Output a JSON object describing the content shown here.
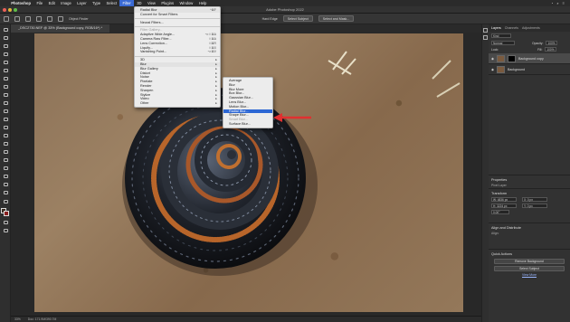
{
  "menubar": {
    "app": "Photoshop",
    "items": [
      "File",
      "Edit",
      "Image",
      "Layer",
      "Type",
      "Select",
      "Filter",
      "3D",
      "View",
      "Plugins",
      "Window",
      "Help"
    ],
    "active": "Filter"
  },
  "window": {
    "title": "Adobe Photoshop 2022",
    "tab": "_DSC2730.NEF @ 33% (Background copy, RGB/16*) *"
  },
  "options": {
    "object_finder": "Object Finder",
    "hard_edge": "Hard Edge",
    "select_subject": "Select Subject",
    "select_mask": "Select and Mask..."
  },
  "filter_menu": {
    "items": [
      {
        "label": "Radial Blur",
        "shortcut": "^⌘F",
        "state": "highlight"
      },
      {
        "label": "Convert for Smart Filters"
      },
      {
        "sep": true
      },
      {
        "label": "Neural Filters..."
      },
      {
        "sep": true
      },
      {
        "label": "Filter Gallery...",
        "state": "disabled"
      },
      {
        "label": "Adaptive Wide Angle...",
        "shortcut": "⌥⇧⌘A"
      },
      {
        "label": "Camera Raw Filter...",
        "shortcut": "⇧⌘A"
      },
      {
        "label": "Lens Correction...",
        "shortcut": "⇧⌘R"
      },
      {
        "label": "Liquify...",
        "shortcut": "⇧⌘X"
      },
      {
        "label": "Vanishing Point...",
        "shortcut": "⌥⌘V"
      },
      {
        "sep": true
      },
      {
        "label": "3D",
        "submenu": true
      },
      {
        "label": "Blur",
        "submenu": true,
        "state": "highlight"
      },
      {
        "label": "Blur Gallery",
        "submenu": true
      },
      {
        "label": "Distort",
        "submenu": true
      },
      {
        "label": "Noise",
        "submenu": true
      },
      {
        "label": "Pixelate",
        "submenu": true
      },
      {
        "label": "Render",
        "submenu": true
      },
      {
        "label": "Sharpen",
        "submenu": true
      },
      {
        "label": "Stylize",
        "submenu": true
      },
      {
        "label": "Video",
        "submenu": true
      },
      {
        "label": "Other",
        "submenu": true
      }
    ]
  },
  "blur_submenu": {
    "items": [
      {
        "label": "Average"
      },
      {
        "label": "Blur"
      },
      {
        "label": "Blur More"
      },
      {
        "label": "Box Blur..."
      },
      {
        "label": "Gaussian Blur..."
      },
      {
        "label": "Lens Blur..."
      },
      {
        "label": "Motion Blur..."
      },
      {
        "label": "Radial Blur...",
        "state": "selected"
      },
      {
        "label": "Shape Blur..."
      },
      {
        "label": "Smart Blur...",
        "state": "disabled"
      },
      {
        "label": "Surface Blur..."
      }
    ]
  },
  "layers_panel": {
    "tabs": [
      "Layers",
      "Channels",
      "Adjustments"
    ],
    "kind": "Kind",
    "blend_mode": "Normal",
    "opacity_label": "Opacity:",
    "opacity": "100%",
    "lock_label": "Lock:",
    "fill_label": "Fill:",
    "fill": "100%",
    "layers": [
      {
        "name": "Background copy",
        "selected": true,
        "mask": true
      },
      {
        "name": "Background",
        "selected": false,
        "mask": false
      }
    ]
  },
  "properties": {
    "title": "Properties",
    "pixel_layer": "Pixel Layer",
    "transform": "Transform",
    "w": "W: 4836 px",
    "h": "H: 3224 px",
    "x": "X: 0 px",
    "y": "Y: 0 px",
    "angle": "0.00°",
    "align": "Align and Distribute",
    "align_sub": "Align:",
    "quick_actions": "Quick Actions",
    "remove_bg": "Remove Background",
    "select_subject": "Select Subject",
    "view_more": "View More"
  },
  "status": {
    "zoom": "33%",
    "doc": "Doc: 171.9M/390.7M"
  },
  "colors": {
    "accent": "#2d67d4",
    "arrow": "#e03030"
  }
}
